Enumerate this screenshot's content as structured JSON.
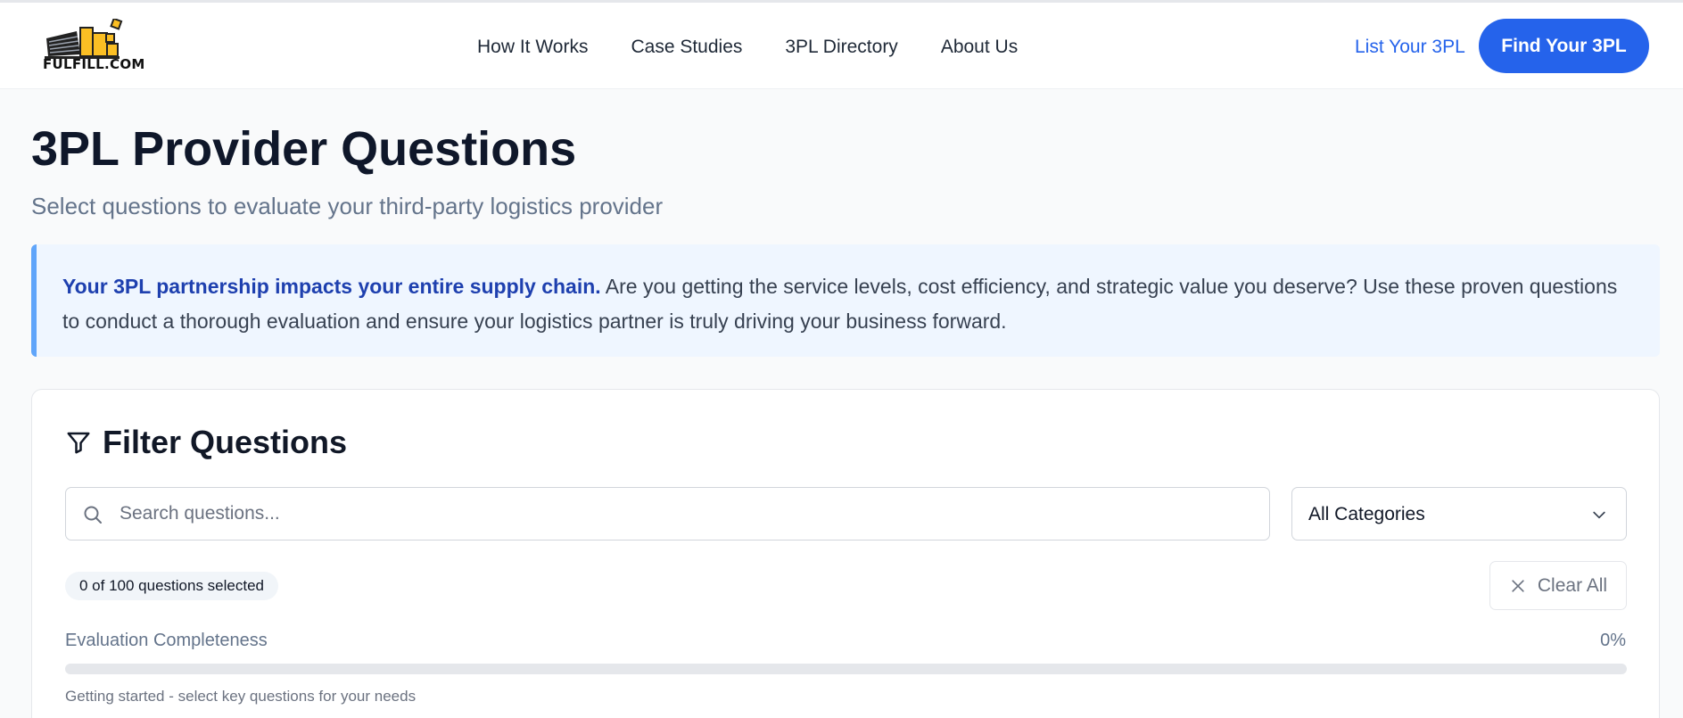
{
  "brand": {
    "logo_text": "FULFILL.COM",
    "accent": "#2563eb",
    "logo_yellow": "#fbbf24"
  },
  "nav": {
    "items": [
      {
        "label": "How It Works"
      },
      {
        "label": "Case Studies"
      },
      {
        "label": "3PL Directory"
      },
      {
        "label": "About Us"
      }
    ],
    "list_link": "List Your 3PL",
    "find_button": "Find Your 3PL"
  },
  "page": {
    "title": "3PL Provider Questions",
    "subtitle": "Select questions to evaluate your third-party logistics provider"
  },
  "callout": {
    "bold": "Your 3PL partnership impacts your entire supply chain.",
    "text": " Are you getting the service levels, cost efficiency, and strategic value you deserve? Use these proven questions to conduct a thorough evaluation and ensure your logistics partner is truly driving your business forward."
  },
  "filter": {
    "title": "Filter Questions",
    "title_icon": "filter-icon",
    "search_placeholder": "Search questions...",
    "search_value": "",
    "search_icon": "search-icon",
    "category_selected": "All Categories",
    "selected_count": "0 of 100 questions selected",
    "clear_label": "Clear All"
  },
  "progress": {
    "label": "Evaluation Completeness",
    "percent_text": "0%",
    "fraction": 0,
    "hint": "Getting started - select key questions for your needs"
  }
}
